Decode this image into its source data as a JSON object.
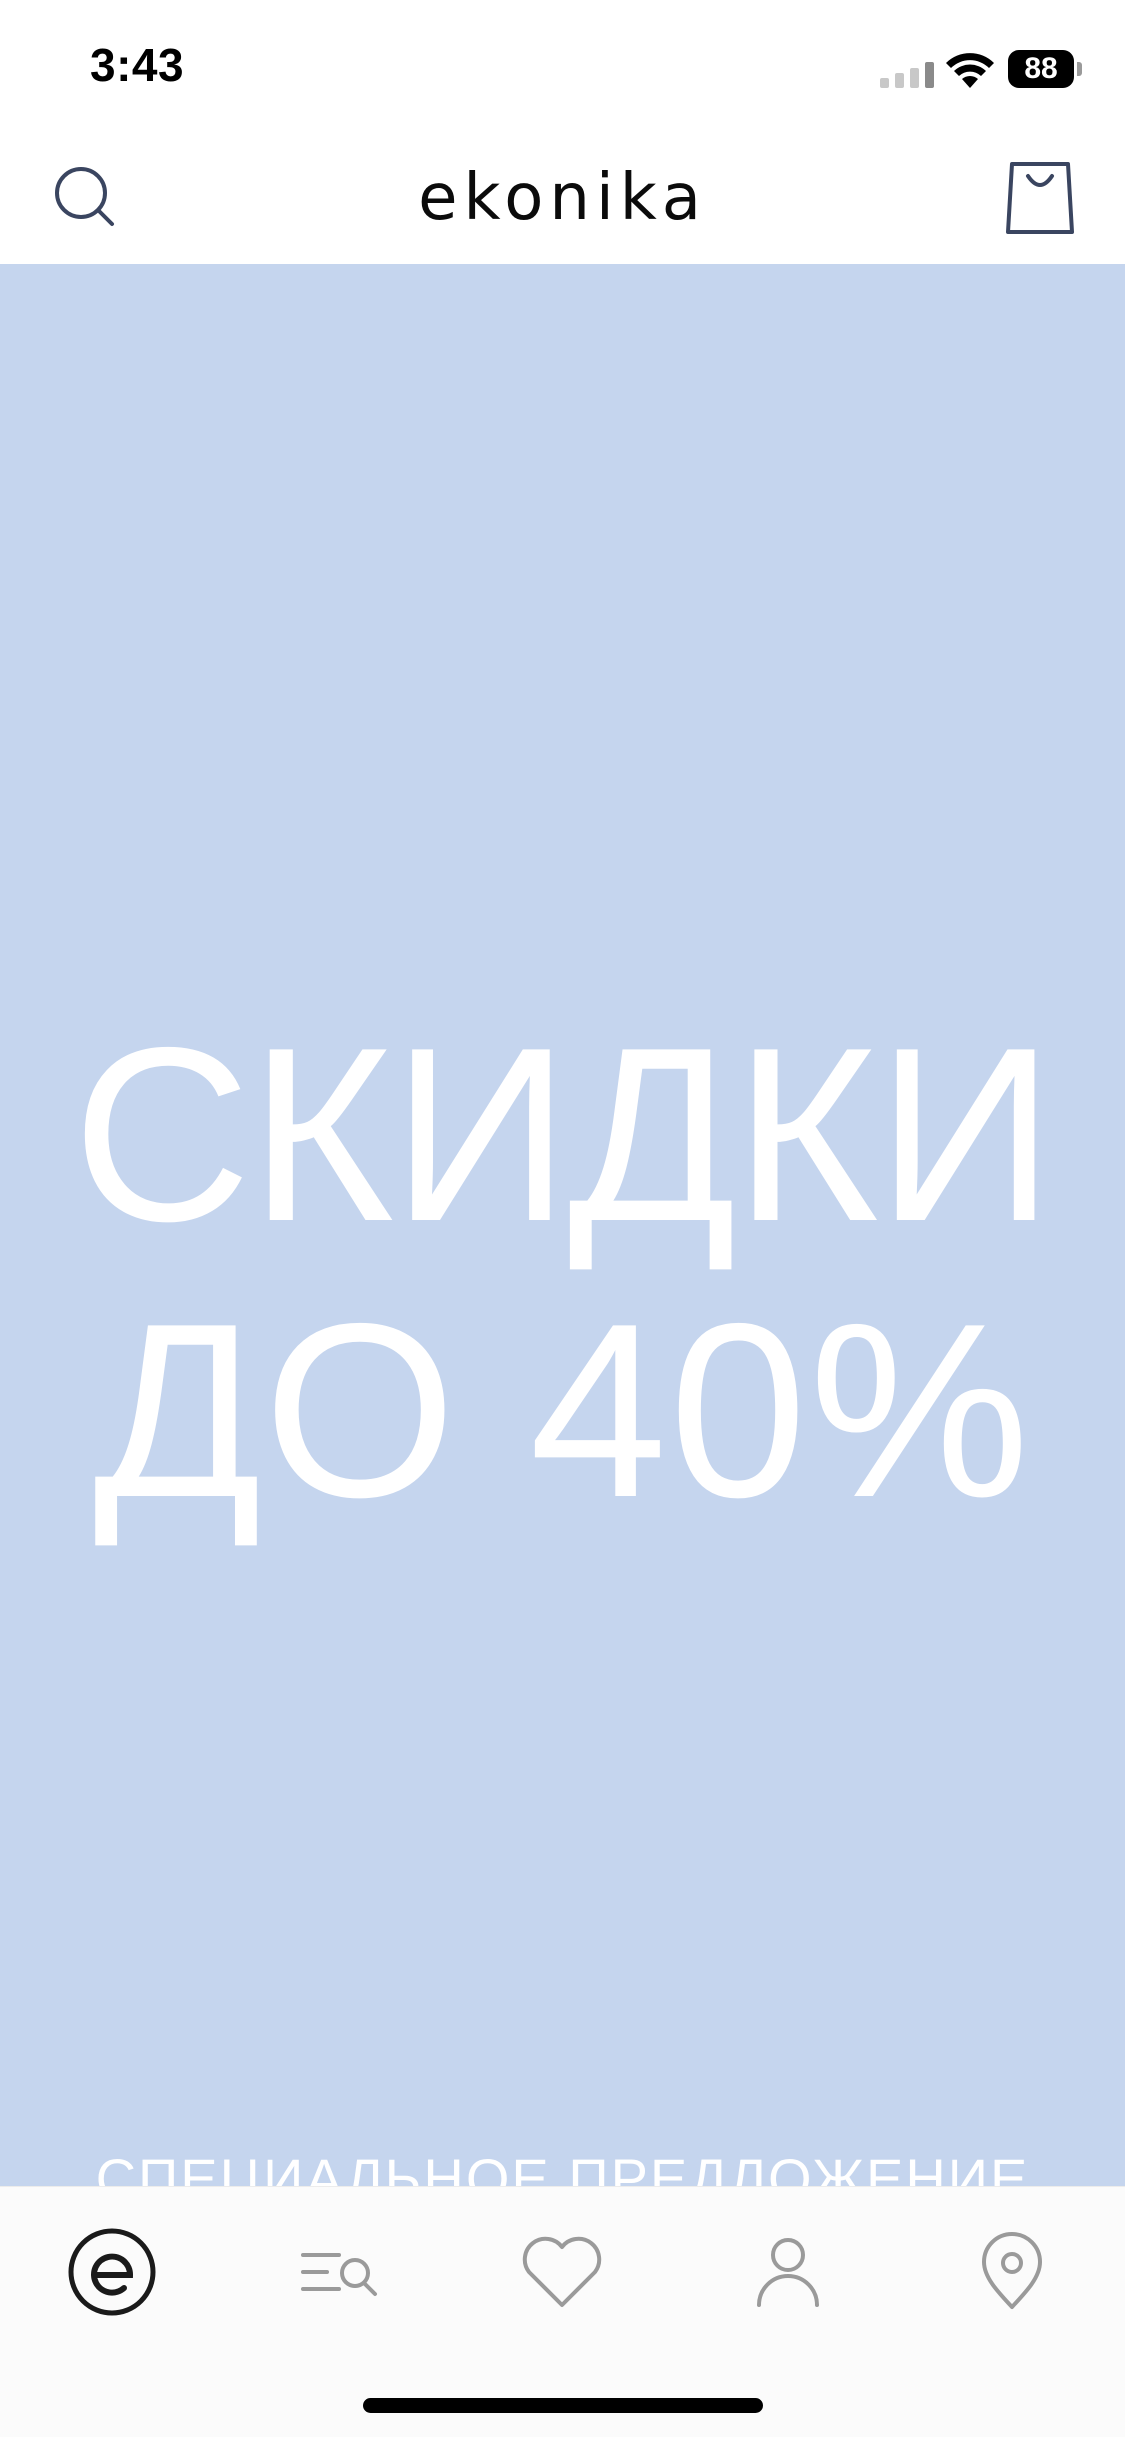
{
  "status_bar": {
    "time": "3:43",
    "battery_level": "88",
    "icons": [
      "cellular-signal-icon",
      "wifi-icon",
      "battery-icon"
    ]
  },
  "header": {
    "brand": "ekonika",
    "search_icon": "search-icon",
    "bag_icon": "shopping-bag-icon"
  },
  "hero": {
    "line1": "СКИДКИ",
    "line2": "ДО 40%",
    "subtitle": "СПЕЦИАЛЬНОЕ ПРЕДЛОЖЕНИЕ",
    "background_color": "#c5d5ee",
    "text_color": "#ffffff"
  },
  "tab_bar": {
    "tabs": [
      {
        "icon": "home-logo-icon",
        "active": true
      },
      {
        "icon": "catalog-search-icon",
        "active": false
      },
      {
        "icon": "heart-icon",
        "active": false
      },
      {
        "icon": "user-icon",
        "active": false
      },
      {
        "icon": "location-pin-icon",
        "active": false
      }
    ]
  },
  "colors": {
    "header_icon": "#3a4560",
    "tab_inactive": "#9a9a9a",
    "tab_active": "#1a1a1a"
  }
}
